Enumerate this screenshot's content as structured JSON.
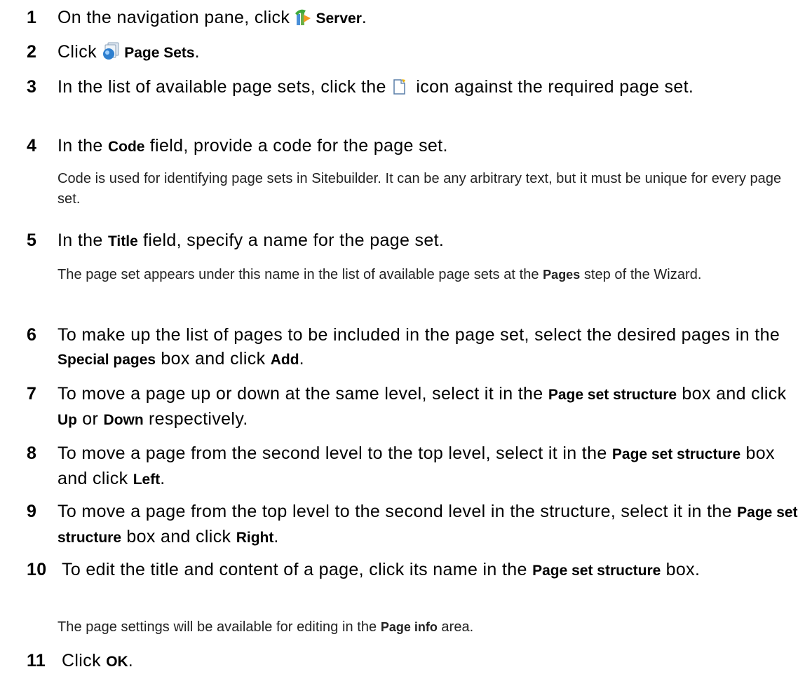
{
  "steps": [
    {
      "num": "1",
      "pre": "On the navigation pane, click ",
      "icon": "server-icon",
      "bold": "Server",
      "post": "."
    },
    {
      "num": "2",
      "pre": "Click ",
      "icon": "page-sets-icon",
      "bold": "Page Sets",
      "post": "."
    },
    {
      "num": "3",
      "pre": "In the list of available page sets, click the ",
      "icon": "edit-page-icon",
      "post": " icon against the required page set."
    },
    {
      "num": "4",
      "pre": "In the ",
      "bold": "Code",
      "post": " field, provide a code for the page set.",
      "note": "Code is used for identifying page sets in Sitebuilder. It can be any arbitrary text, but it must be unique for every page set."
    },
    {
      "num": "5",
      "pre": "In the ",
      "bold": "Title",
      "post": " field, specify a name for the page set.",
      "note_pre": "The page set appears under this name in the list of available page sets at the ",
      "note_bold": "Pages",
      "note_post": " step of the Wizard."
    },
    {
      "num": "6",
      "pre": "To make up the list of pages to be included in the page set, select the desired pages in the ",
      "bold": "Special pages",
      "mid": " box and click ",
      "bold2": "Add",
      "post": "."
    },
    {
      "num": "7",
      "pre": "To move a page up or down at the same level, select it in the ",
      "bold": "Page set structure",
      "mid": " box and click ",
      "bold2": "Up",
      "mid2": " or ",
      "bold3": "Down",
      "post": " respectively."
    },
    {
      "num": "8",
      "pre": "To move a page from the second level to the top level, select it in the ",
      "bold": "Page set structure",
      "mid": " box and click ",
      "bold2": "Left",
      "post": "."
    },
    {
      "num": "9",
      "pre": "To move a page from the top level to the second level in the structure, select it in the ",
      "bold": "Page set structure",
      "mid": " box and click ",
      "bold2": "Right",
      "post": "."
    },
    {
      "num": "10",
      "pre": "To edit the title and content of a page, click its name in the ",
      "bold": "Page set structure",
      "post": " box.",
      "note_pre": "The page settings will be available for editing in the ",
      "note_bold": "Page info",
      "note_post": " area."
    },
    {
      "num": "11",
      "pre": "Click ",
      "bold": "OK",
      "post": "."
    }
  ]
}
